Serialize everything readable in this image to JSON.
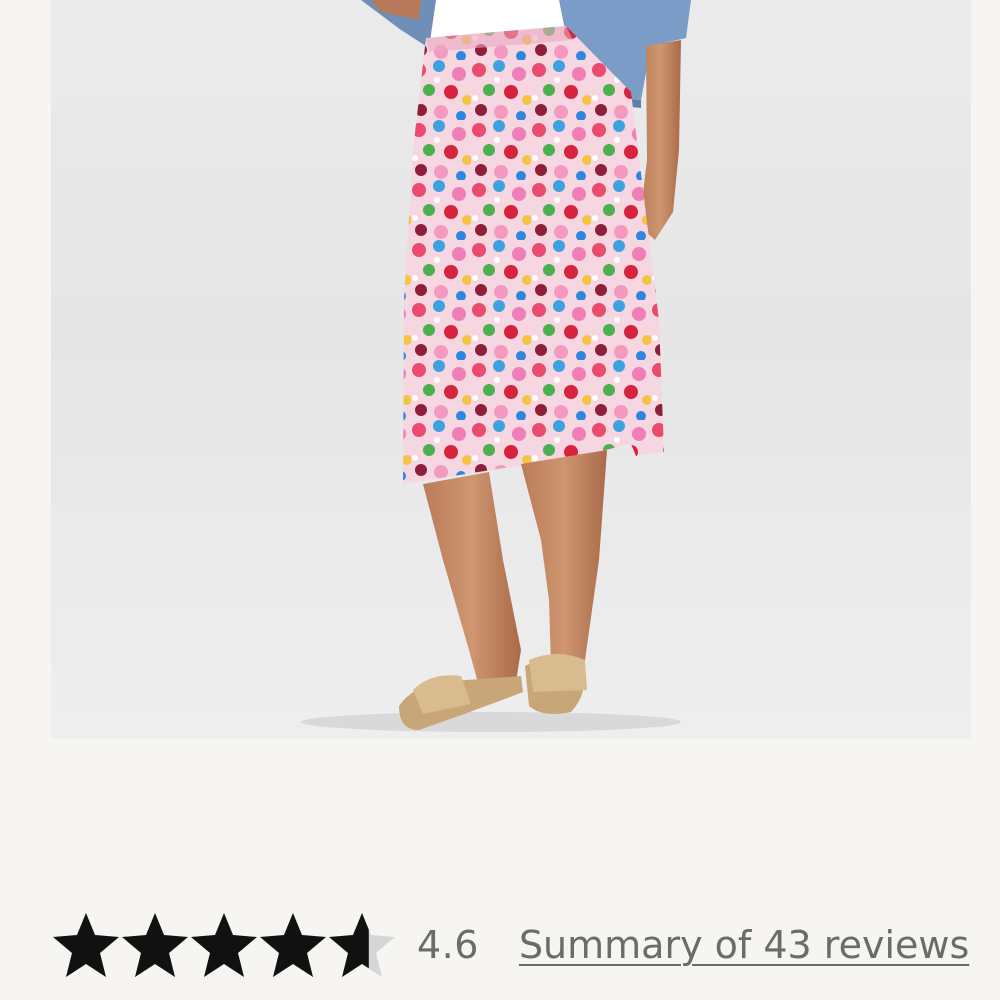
{
  "product": {
    "image_label": "product-photo",
    "colors": {
      "background": "#f7f5f1",
      "photo_backdrop": "#e9e9e9",
      "star_filled": "#111111",
      "star_empty": "#d6d6d6",
      "text_muted": "#6b6b6b"
    }
  },
  "rating": {
    "value": "4.6",
    "stars_max": 5,
    "stars_filled_fraction": 0.92,
    "summary_link": "Summary of 43 reviews"
  }
}
